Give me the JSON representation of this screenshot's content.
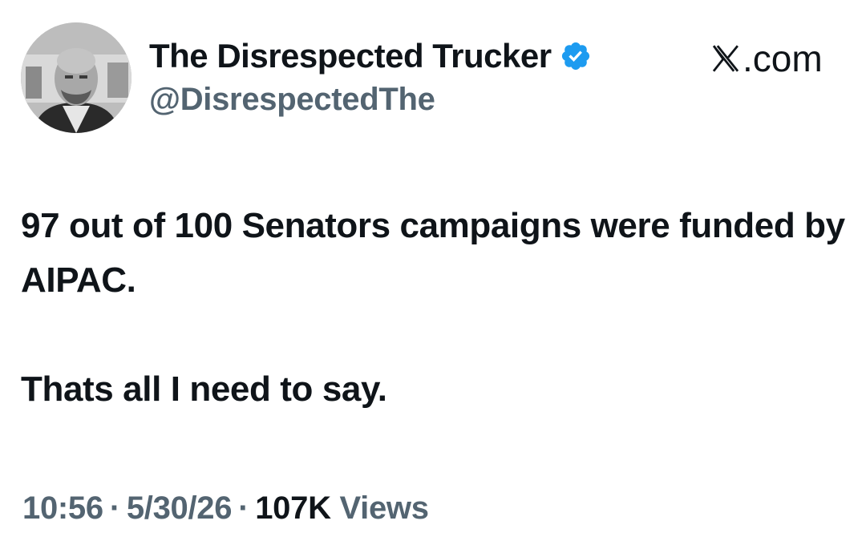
{
  "author": {
    "display_name": "The Disrespected Trucker",
    "handle": "@DisrespectedThe",
    "verified_icon": "verified-badge-icon",
    "verified_color": "#1d9bf0"
  },
  "site": {
    "label": ".com",
    "logo_icon": "x-logo-icon"
  },
  "post": {
    "paragraphs": [
      "97 out of 100 Senators campaigns were funded by AIPAC.",
      "Thats all I need to say."
    ]
  },
  "meta": {
    "time": "10:56",
    "date": "5/30/26",
    "separator": "·",
    "views_count": "107K",
    "views_label": "Views"
  },
  "colors": {
    "text_primary": "#0f1419",
    "text_secondary": "#536471",
    "background": "#ffffff"
  }
}
